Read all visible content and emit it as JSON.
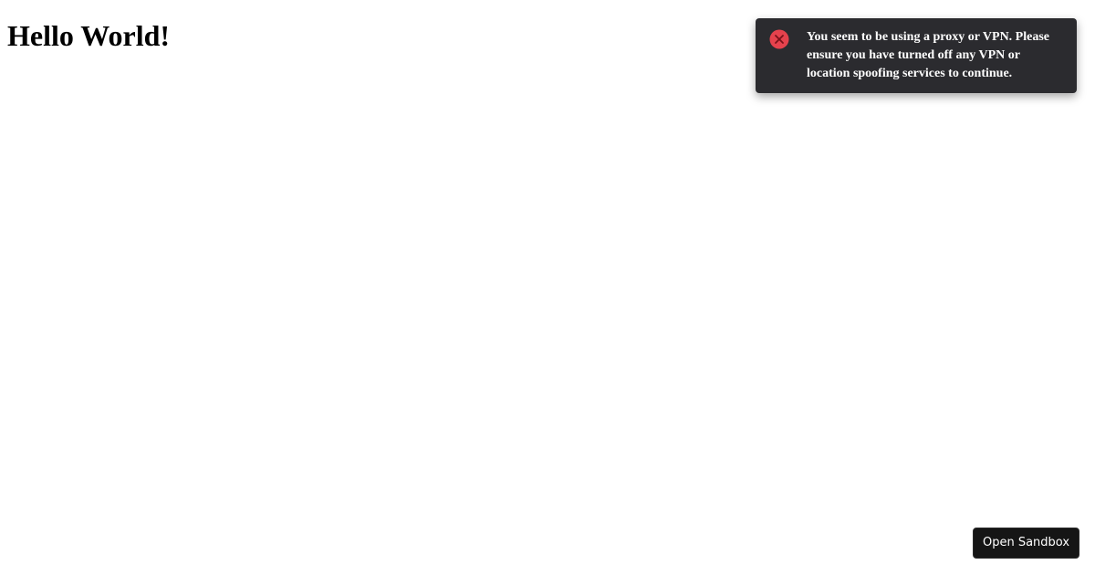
{
  "page": {
    "heading": "Hello World!"
  },
  "toast": {
    "type": "error",
    "icon": "error-circle-x-icon",
    "icon_color": "#e5424d",
    "background": "#2b2b2f",
    "message": "You seem to be using a proxy or VPN. Please ensure you have turned off any VPN or location spoofing services to continue."
  },
  "sandbox": {
    "button_label": "Open Sandbox"
  }
}
